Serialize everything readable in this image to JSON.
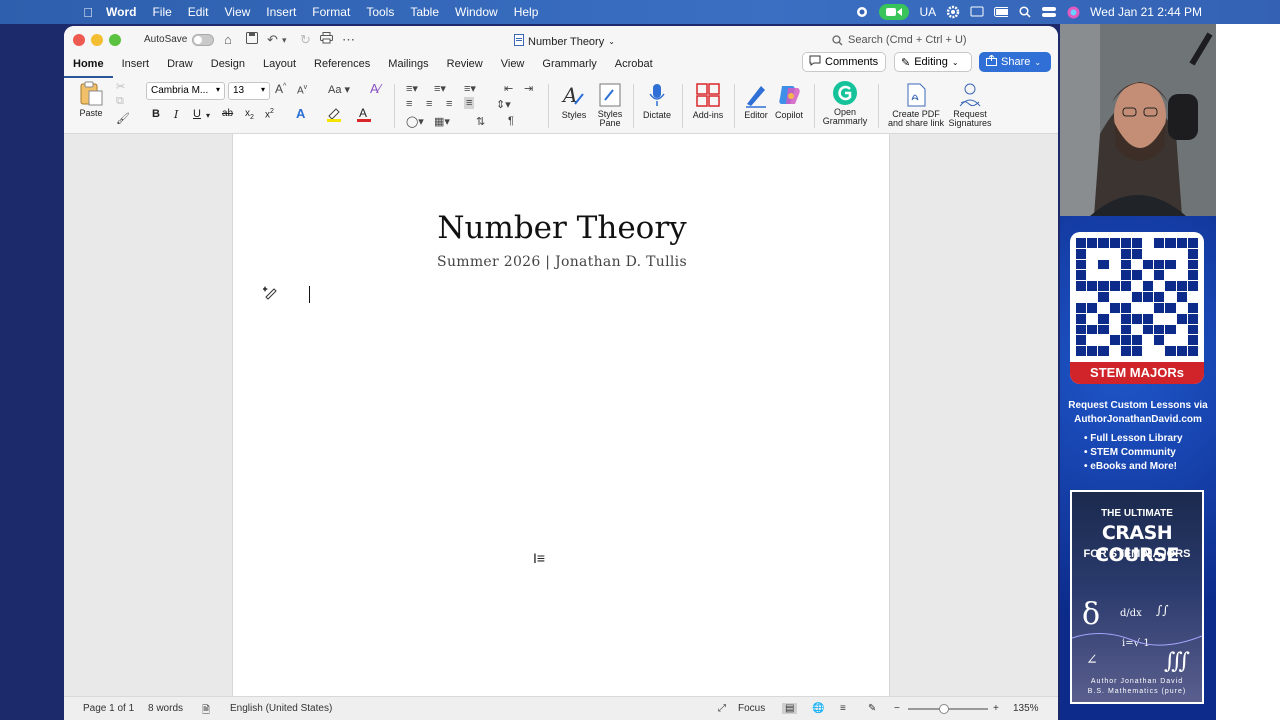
{
  "menubar": {
    "app": "Word",
    "items": [
      "File",
      "Edit",
      "View",
      "Insert",
      "Format",
      "Tools",
      "Table",
      "Window",
      "Help"
    ],
    "input_source": "UA",
    "clock": "Wed Jan 21  2:44 PM"
  },
  "titlebar": {
    "autosave_label": "AutoSave",
    "doc_title": "Number Theory",
    "search_placeholder": "Search (Cmd + Ctrl + U)"
  },
  "tabs": [
    "Home",
    "Insert",
    "Draw",
    "Design",
    "Layout",
    "References",
    "Mailings",
    "Review",
    "View",
    "Grammarly",
    "Acrobat"
  ],
  "actions": {
    "comments": "Comments",
    "editing": "Editing",
    "share": "Share"
  },
  "ribbon": {
    "paste": "Paste",
    "font_name": "Cambria M...",
    "font_size": "13",
    "styles": "Styles",
    "styles_pane_1": "Styles",
    "styles_pane_2": "Pane",
    "dictate": "Dictate",
    "addins": "Add-ins",
    "editor": "Editor",
    "copilot": "Copilot",
    "open_grammarly_1": "Open",
    "open_grammarly_2": "Grammarly",
    "create_pdf_1": "Create PDF",
    "create_pdf_2": "and share link",
    "request_sig_1": "Request",
    "request_sig_2": "Signatures"
  },
  "document": {
    "title": "Number Theory",
    "subtitle": "Summer 2026 | Jonathan D. Tullis"
  },
  "status": {
    "page": "Page 1 of 1",
    "words": "8 words",
    "language": "English (United States)",
    "focus": "Focus",
    "zoom": "135%",
    "zoom_level": 0.45
  },
  "ad": {
    "qr_label": "STEM MAJORs",
    "request_line1": "Request Custom Lessons via",
    "request_line2": "AuthorJonathanDavid.com",
    "bullets": [
      "• Full Lesson Library",
      "• STEM Community",
      "• eBooks and More!"
    ],
    "book_top": "THE ULTIMATE",
    "book_title": "CRASH COURSE",
    "book_sub": "FOR STEM MAJORS",
    "book_author": "Author Jonathan David",
    "book_degree": "B.S. Mathematics (pure)"
  }
}
